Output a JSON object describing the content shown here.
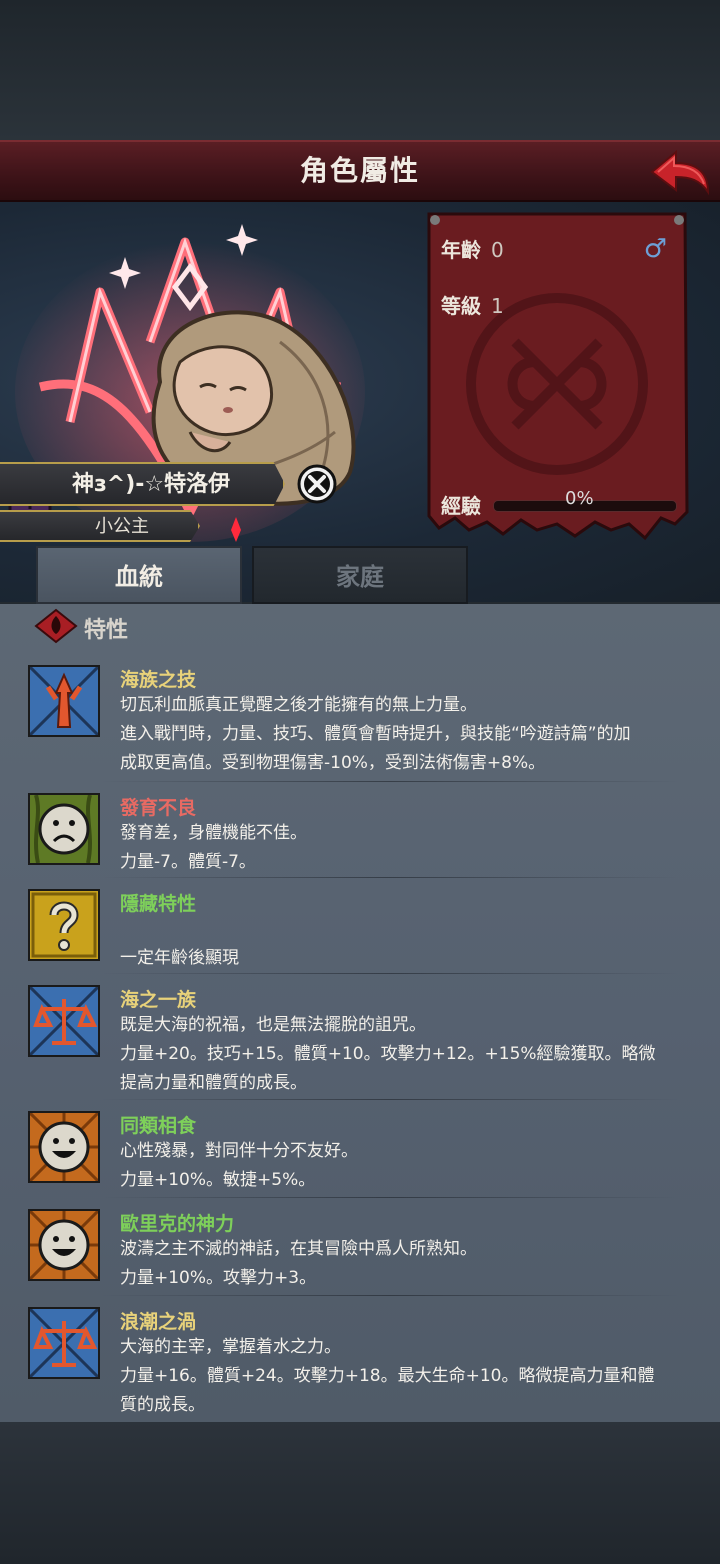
{
  "header": {
    "title": "角色屬性",
    "back_icon": "back-arrow-icon"
  },
  "stats": {
    "age_label": "年齡",
    "age_value": "0",
    "gender_icon": "♂",
    "level_label": "等級",
    "level_value": "1",
    "exp_label": "經驗",
    "exp_value": "0%",
    "exp_fraction": 0
  },
  "character": {
    "name": "神з^)-☆特洛伊",
    "title": "小公主"
  },
  "tabs": [
    {
      "label": "血統",
      "active": true
    },
    {
      "label": "家庭",
      "active": false
    }
  ],
  "section": {
    "title": "特性"
  },
  "traits": [
    {
      "name": "海族之技",
      "name_color": "#e8d27a",
      "icon": "sea-trident-icon",
      "lines": [
        "切瓦利血脈真正覺醒之後才能擁有的無上力量。",
        "進入戰鬥時，力量、技巧、體質會暫時提升，與技能“吟遊詩篇”的加",
        "成取更高值。受到物理傷害-10%，受到法術傷害+8%。"
      ]
    },
    {
      "name": "發育不良",
      "name_color": "#e86a63",
      "icon": "sad-face-icon",
      "lines": [
        "發育差，身體機能不佳。",
        "力量-7。體質-7。"
      ]
    },
    {
      "name": "隱藏特性",
      "name_color": "#7ed05a",
      "icon": "question-mark-icon",
      "lines": [
        "",
        "一定年齡後顯現"
      ]
    },
    {
      "name": "海之一族",
      "name_color": "#e8d27a",
      "icon": "scales-icon",
      "lines": [
        "既是大海的祝福，也是無法擺脫的詛咒。",
        "力量+20。技巧+15。體質+10。攻擊力+12。+15%經驗獲取。略微",
        "提高力量和體質的成長。"
      ]
    },
    {
      "name": "同類相食",
      "name_color": "#7ed05a",
      "icon": "smile-face-icon",
      "lines": [
        "心性殘暴，對同伴十分不友好。",
        "力量+10%。敏捷+5%。"
      ]
    },
    {
      "name": "歐里克的神力",
      "name_color": "#7ed05a",
      "icon": "smile-face-icon",
      "lines": [
        "波濤之主不滅的神話，在其冒險中爲人所熟知。",
        "力量+10%。攻擊力+3。"
      ]
    },
    {
      "name": "浪潮之渦",
      "name_color": "#e8d27a",
      "icon": "scales-icon",
      "lines": [
        "大海的主宰，掌握着水之力。",
        "力量+16。體質+24。攻擊力+18。最大生命+10。略微提高力量和體",
        "質的成長。"
      ]
    }
  ]
}
